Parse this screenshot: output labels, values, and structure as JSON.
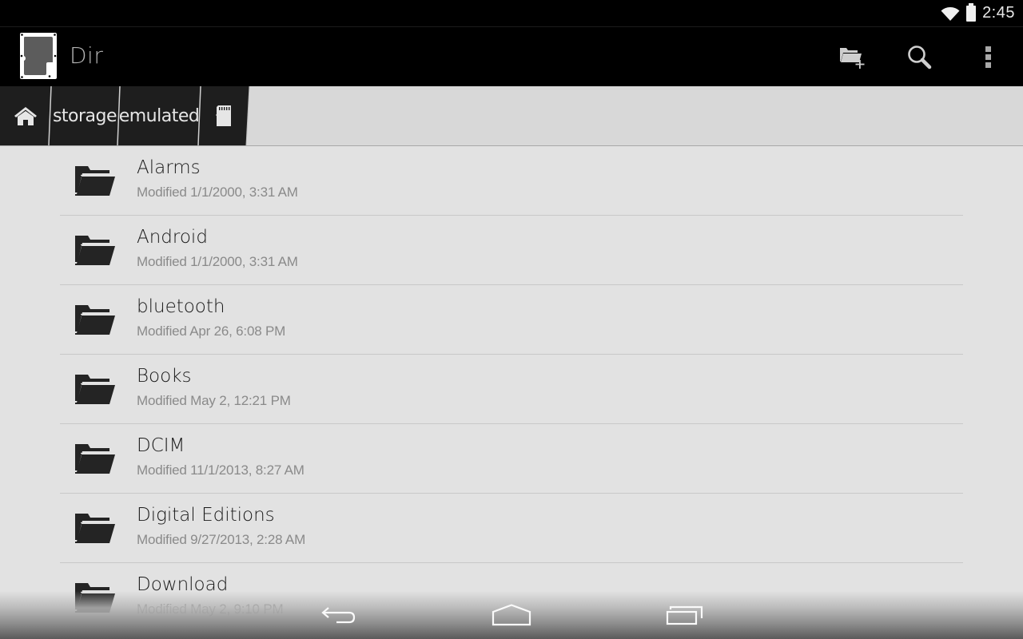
{
  "status_bar": {
    "time": "2:45",
    "icons": [
      "wifi-icon",
      "battery-icon"
    ]
  },
  "action_bar": {
    "app_icon": "sd-card-app-icon",
    "title": "Dir",
    "actions": [
      {
        "name": "new-folder",
        "icon": "folder-plus-icon"
      },
      {
        "name": "search",
        "icon": "search-icon"
      },
      {
        "name": "overflow-menu",
        "icon": "more-vertical-icon"
      }
    ]
  },
  "breadcrumb": {
    "items": [
      {
        "type": "icon",
        "icon": "home-icon"
      },
      {
        "type": "text",
        "label": "storage"
      },
      {
        "type": "text",
        "label": "emulated"
      },
      {
        "type": "icon",
        "icon": "sd-card-icon"
      }
    ]
  },
  "files": [
    {
      "name": "Alarms",
      "modified": "Modified 1/1/2000, 3:31 AM",
      "type": "folder"
    },
    {
      "name": "Android",
      "modified": "Modified 1/1/2000, 3:31 AM",
      "type": "folder"
    },
    {
      "name": "bluetooth",
      "modified": "Modified Apr 26, 6:08 PM",
      "type": "folder"
    },
    {
      "name": "Books",
      "modified": "Modified May 2, 12:21 PM",
      "type": "folder"
    },
    {
      "name": "DCIM",
      "modified": "Modified 11/1/2013, 8:27 AM",
      "type": "folder"
    },
    {
      "name": "Digital Editions",
      "modified": "Modified 9/27/2013, 2:28 AM",
      "type": "folder"
    },
    {
      "name": "Download",
      "modified": "Modified May 2, 9:10 PM",
      "type": "folder"
    }
  ],
  "nav_bar": {
    "buttons": [
      "back-icon",
      "home-icon",
      "recents-icon"
    ]
  },
  "colors": {
    "status_bar_bg": "#000000",
    "action_bar_bg": "#000000",
    "breadcrumb_dark": "#1e1e1e",
    "breadcrumb_light": "#d8d8d8",
    "list_bg": "#e2e2e2",
    "primary_text": "#1a1a1a",
    "secondary_text": "#8a8a8a",
    "folder_icon": "#242424"
  }
}
